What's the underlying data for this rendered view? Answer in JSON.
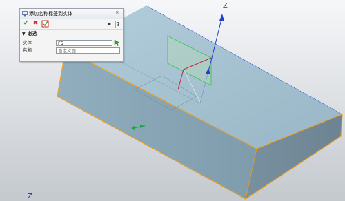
{
  "dialog": {
    "title": "添加名称标签到实体",
    "close_glyph": "☒",
    "toolbar": {
      "ok_glyph": "✔",
      "cancel_glyph": "✖",
      "pin_glyph": "▪",
      "help_glyph": "?"
    },
    "section": {
      "arrow": "▼",
      "label": "必选"
    },
    "fields": [
      {
        "label": "实体",
        "value": "F5"
      },
      {
        "label": "名称",
        "value": "",
        "placeholder": "自定义面"
      }
    ]
  },
  "viewport": {
    "axis_labels": [
      "Z",
      "Z"
    ],
    "colors": {
      "background_top": "#f5f6f8",
      "background_bottom": "#c6cbd0",
      "top_face": "#a6c3d3",
      "front_face": "#86a4b4",
      "side_face": "#7a8f9b",
      "edge_highlight": "#f0a020",
      "axis": "#1f3fd0"
    }
  }
}
